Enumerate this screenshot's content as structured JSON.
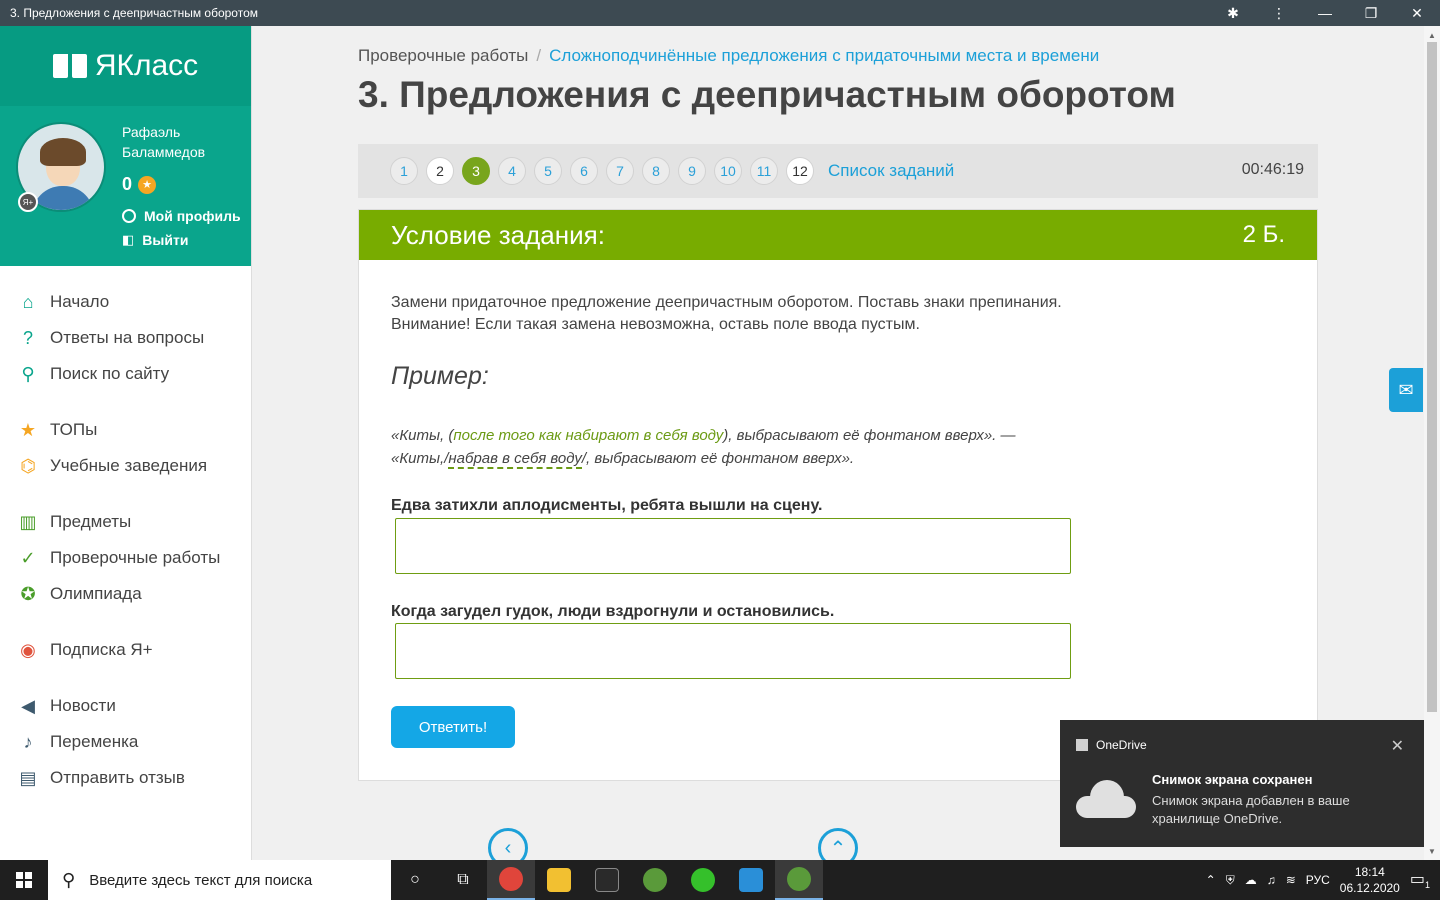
{
  "window": {
    "title": "3. Предложения с деепричастным оборотом"
  },
  "sidebar": {
    "logo_text": "ЯКласс",
    "user": {
      "name": "Рафаэль Баламмедов",
      "points": "0",
      "badge": "Я+"
    },
    "profile_link": "Мой профиль",
    "logout_link": "Выйти",
    "nav": [
      {
        "label": "Начало",
        "icon": "home-icon"
      },
      {
        "label": "Ответы на вопросы",
        "icon": "question-icon"
      },
      {
        "label": "Поиск по сайту",
        "icon": "search-icon"
      },
      {
        "label": "ТОПы",
        "icon": "star-icon"
      },
      {
        "label": "Учебные заведения",
        "icon": "institution-icon"
      },
      {
        "label": "Предметы",
        "icon": "book-icon"
      },
      {
        "label": "Проверочные работы",
        "icon": "check-circle-icon"
      },
      {
        "label": "Олимпиада",
        "icon": "medal-icon"
      },
      {
        "label": "Подписка Я+",
        "icon": "subscription-icon"
      },
      {
        "label": "Новости",
        "icon": "megaphone-icon"
      },
      {
        "label": "Переменка",
        "icon": "bell-icon"
      },
      {
        "label": "Отправить отзыв",
        "icon": "feedback-icon"
      }
    ]
  },
  "breadcrumb": {
    "root": "Проверочные работы",
    "separator": "/",
    "current": "Сложноподчинённые предложения с придаточными места и времени"
  },
  "page_title": "3. Предложения с деепричастным оборотом",
  "task_nav": {
    "numbers": [
      "1",
      "2",
      "3",
      "4",
      "5",
      "6",
      "7",
      "8",
      "9",
      "10",
      "11",
      "12"
    ],
    "active": "3",
    "done": [
      "2",
      "12"
    ],
    "list_label": "Список заданий",
    "timer": "00:46:19"
  },
  "task": {
    "header": "Условие задания:",
    "points": "2 Б.",
    "instruction_line1": "Замени придаточное предложение деепричастным оборотом. Поставь знаки препинания.",
    "instruction_line2": "Внимание! Если такая замена невозможна, оставь поле ввода пустым.",
    "example_heading": "Пример:",
    "example": {
      "l1_pre": "«Киты, (",
      "l1_hl": "после того как набирают в себя воду",
      "l1_post": "), выбрасывают её фонтаном вверх». —",
      "l2_pre": "«Киты,/",
      "l2_hl": "набрав в себя воду",
      "l2_post": "/, выбрасывают её фонтаном вверх»."
    },
    "questions": [
      {
        "text": "Едва затихли аплодисменты, ребята вышли на сцену.",
        "value": ""
      },
      {
        "text": "Когда загудел гудок, люди вздрогнули и остановились.",
        "value": ""
      }
    ],
    "submit_label": "Ответить!"
  },
  "notification": {
    "app": "OneDrive",
    "title": "Снимок экрана сохранен",
    "text": "Снимок экрана добавлен в ваше хранилище OneDrive."
  },
  "taskbar": {
    "search_placeholder": "Введите здесь текст для поиска",
    "language": "РУС",
    "time": "18:14",
    "date": "06.12.2020",
    "notification_count": "1"
  },
  "colors": {
    "brand_teal": "#0aa58c",
    "task_green": "#78ac00",
    "link_blue": "#1ca0d8",
    "button_blue": "#14a7e6"
  }
}
